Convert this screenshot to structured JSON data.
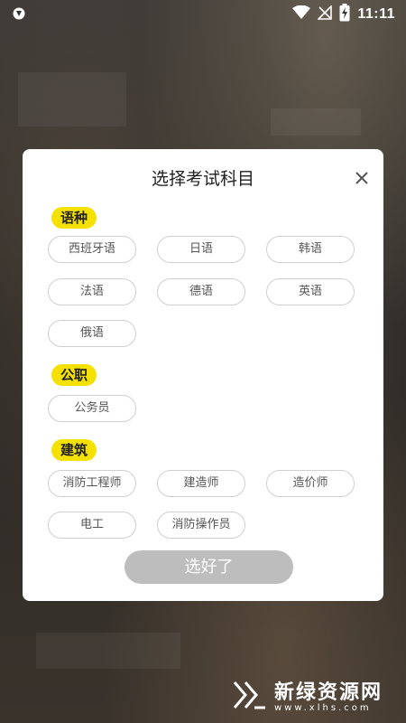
{
  "status_bar": {
    "time": "11:11",
    "icons": [
      "shield-icon",
      "wifi-icon",
      "no-signal-icon",
      "battery-charging-icon"
    ]
  },
  "dialog": {
    "title": "选择考试科目",
    "close_icon": "close-icon",
    "sections": [
      {
        "label": "语种",
        "options": [
          "西班牙语",
          "日语",
          "韩语",
          "法语",
          "德语",
          "英语",
          "俄语"
        ]
      },
      {
        "label": "公职",
        "options": [
          "公务员"
        ]
      },
      {
        "label": "建筑",
        "options": [
          "消防工程师",
          "建造师",
          "造价师",
          "电工",
          "消防操作员"
        ]
      }
    ],
    "confirm_label": "选好了"
  },
  "watermark": {
    "title": "新绿资源网",
    "url": "www.xlhs.com"
  },
  "colors": {
    "tag_bg": "#f5e100",
    "button_disabled": "#bdbdbd",
    "option_border": "#cfcfcf"
  }
}
